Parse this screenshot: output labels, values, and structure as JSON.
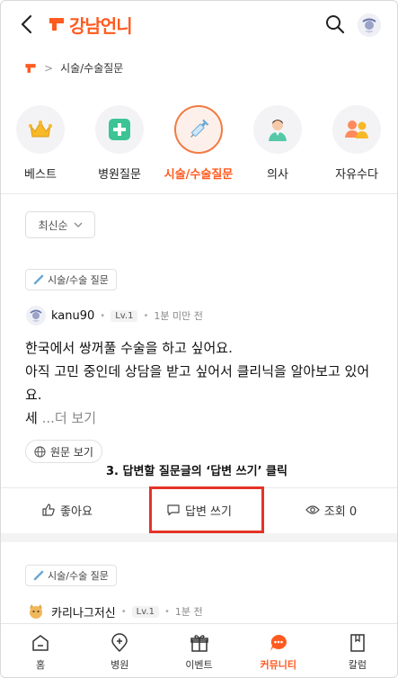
{
  "header": {
    "logo_text": "강남언니"
  },
  "breadcrumb": {
    "current": "시술/수술질문"
  },
  "categories": [
    {
      "label": "베스트",
      "icon": "crown-icon"
    },
    {
      "label": "병원질문",
      "icon": "hospital-cross-icon"
    },
    {
      "label": "시술/수술질문",
      "icon": "syringe-icon",
      "active": true
    },
    {
      "label": "의사",
      "icon": "doctor-icon"
    },
    {
      "label": "자유수다",
      "icon": "people-icon"
    }
  ],
  "sort": {
    "label": "최신순"
  },
  "post1": {
    "tag": "시술/수술 질문",
    "author": "kanu90",
    "level": "Lv.1",
    "time": "1분 미만 전",
    "lines": [
      "한국에서 쌍꺼풀 수술을 하고 싶어요.",
      "아직 고민 중인데 상담을 받고 싶어서 클리닉을 알아보고 있어",
      "요."
    ],
    "last_line_prefix": "세 ",
    "more": "...더 보기",
    "original_button": "원문 보기"
  },
  "annotation": "3. 답변할 질문글의 ‘답변 쓰기’ 클릭",
  "actions": {
    "like": "좋아요",
    "answer": "답변 쓰기",
    "views": "조회 0"
  },
  "post2": {
    "tag": "시술/수술 질문",
    "author": "카리나그저신",
    "level": "Lv.1",
    "time": "1분 전"
  },
  "nav": [
    {
      "label": "홈",
      "icon": "home-icon"
    },
    {
      "label": "병원",
      "icon": "map-pin-icon"
    },
    {
      "label": "이벤트",
      "icon": "gift-icon"
    },
    {
      "label": "커뮤니티",
      "icon": "chat-bubble-icon",
      "active": true
    },
    {
      "label": "칼럼",
      "icon": "bookmark-book-icon"
    }
  ],
  "colors": {
    "brand": "#ff5a1f",
    "highlight_box": "#e53327"
  }
}
